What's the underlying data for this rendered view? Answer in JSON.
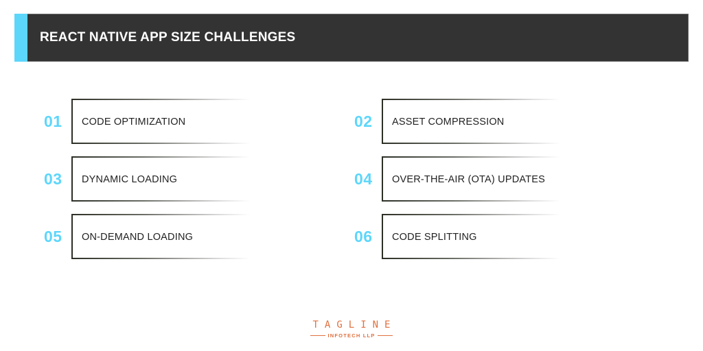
{
  "header": {
    "title": "REACT NATIVE APP SIZE CHALLENGES"
  },
  "colors": {
    "accent": "#5dd6fb",
    "header_bg": "#333333",
    "logo": "#e0703f"
  },
  "items": [
    {
      "number": "01",
      "label": "CODE OPTIMIZATION"
    },
    {
      "number": "02",
      "label": "ASSET COMPRESSION"
    },
    {
      "number": "03",
      "label": "DYNAMIC LOADING"
    },
    {
      "number": "04",
      "label": "OVER-THE-AIR (OTA) UPDATES"
    },
    {
      "number": "05",
      "label": "ON-DEMAND LOADING"
    },
    {
      "number": "06",
      "label": "CODE SPLITTING"
    }
  ],
  "logo": {
    "brand": "TAGLINE",
    "subtitle": "INFOTECH LLP"
  }
}
